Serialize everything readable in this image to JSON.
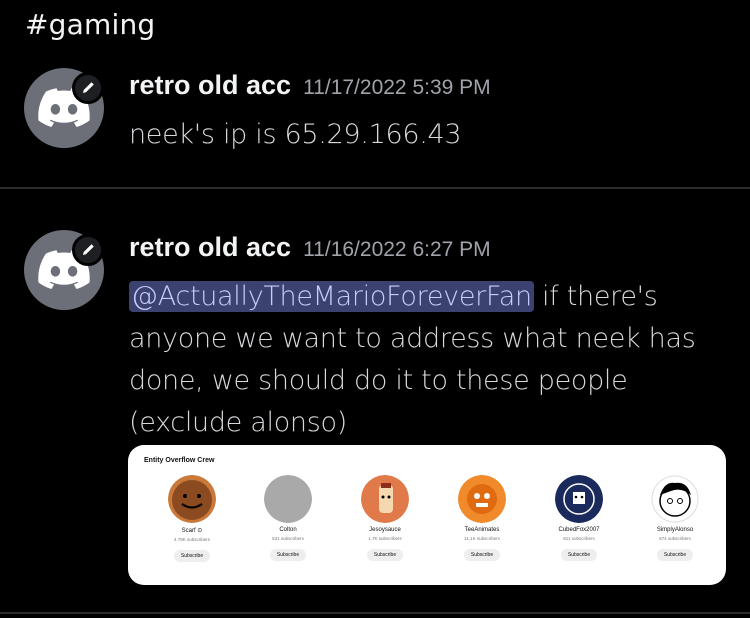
{
  "channel": {
    "title": "#gaming"
  },
  "messages": [
    {
      "username": "retro old acc",
      "timestamp": "11/17/2022 5:39 PM",
      "text": "neek's ip is 65.29.166.43"
    },
    {
      "username": "retro old acc",
      "timestamp": "11/16/2022 6:27 PM",
      "mention": "@ActuallyTheMarioForeverFan",
      "text_line1_rest": " if there's",
      "text_rest": "anyone we want to address what neek has done, we should do it to these people (exclude alonso)",
      "embed": {
        "title": "Entity Overflow Crew",
        "channels": [
          {
            "name": "Scarf ⊙",
            "subs": "4.78K subscribers",
            "button": "Subscribe",
            "color": "#8b4a1f"
          },
          {
            "name": "Colton",
            "subs": "531 subscribers",
            "button": "Subscribe",
            "color": "#a9a9a9"
          },
          {
            "name": "Jesoysauce",
            "subs": "1.7K subscribers",
            "button": "Subscribe",
            "color": "#e07a4a"
          },
          {
            "name": "TeeAnimates",
            "subs": "11.1K subscribers",
            "button": "Subscribe",
            "color": "#f08a2a"
          },
          {
            "name": "CubedFox2007",
            "subs": "811 subscribers",
            "button": "Subscribe",
            "color": "#1b2a5c"
          },
          {
            "name": "SimplyAlonso",
            "subs": "674 subscribers",
            "button": "Subscribe",
            "color": "#ffffff"
          }
        ]
      }
    }
  ],
  "icons": {
    "avatar": "discord-logo-icon",
    "badge": "pencil-icon"
  }
}
